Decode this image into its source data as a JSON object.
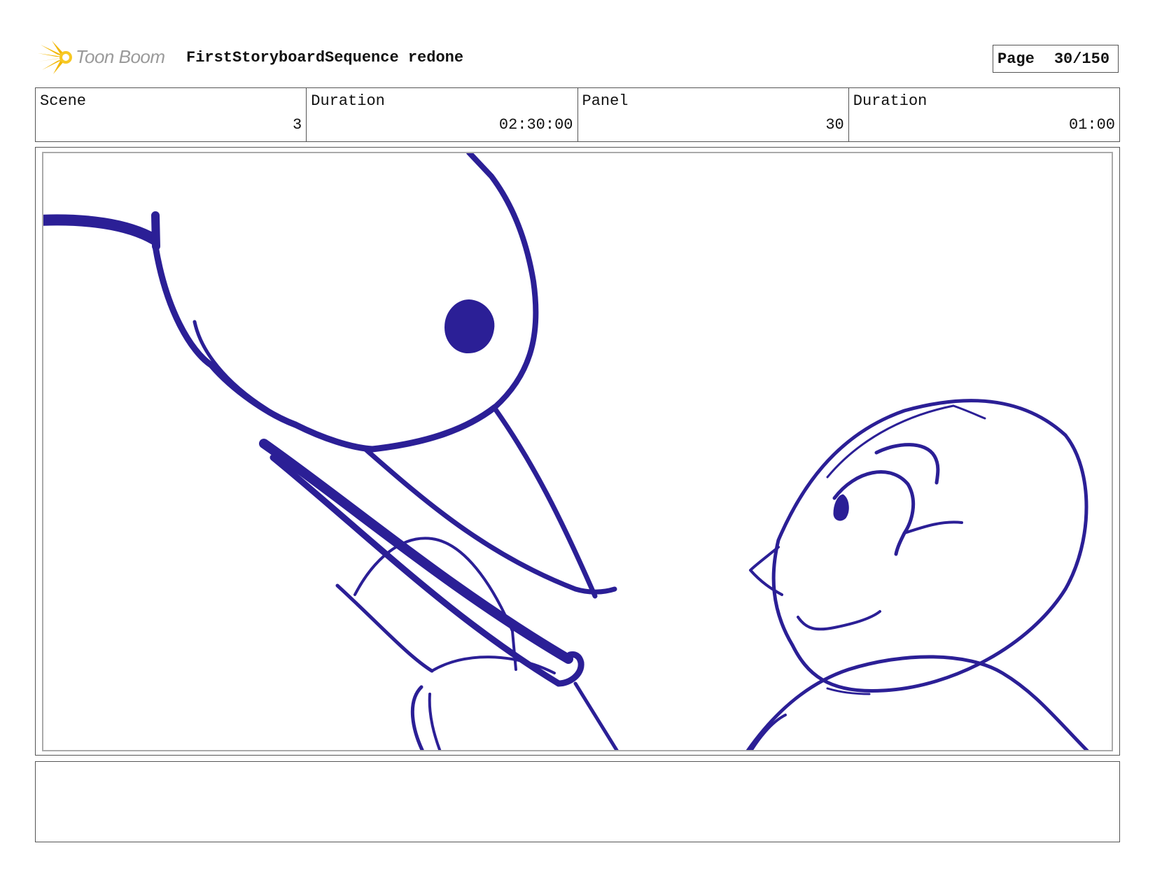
{
  "header": {
    "brand": "Toon Boom",
    "title": "FirstStoryboardSequence redone",
    "page_label": "Page",
    "page_value": "30/150"
  },
  "info": [
    {
      "label": "Scene",
      "value": "3"
    },
    {
      "label": "Duration",
      "value": "02:30:00"
    },
    {
      "label": "Panel",
      "value": "30"
    },
    {
      "label": "Duration",
      "value": "01:00"
    }
  ],
  "notes": "",
  "colors": {
    "sketch": "#2b1f96",
    "logo": "#f2b705",
    "brand_text": "#9a9a9a"
  }
}
